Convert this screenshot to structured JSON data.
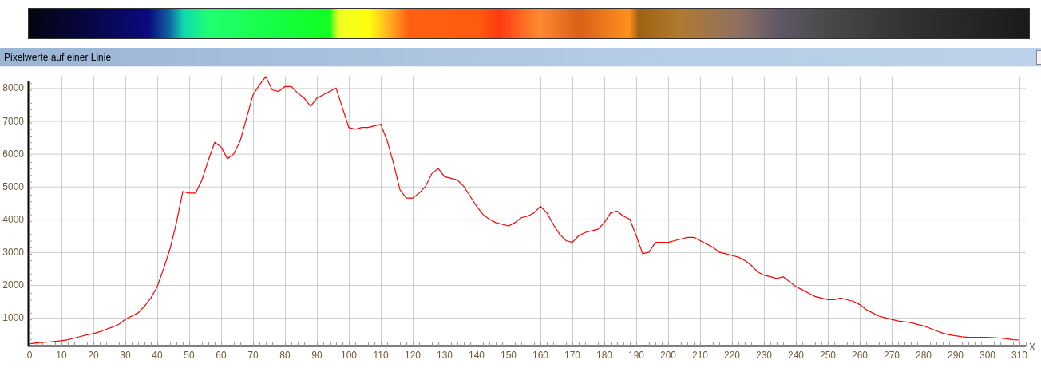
{
  "panel": {
    "title": "Pixelwerte auf einer Linie"
  },
  "chart": {
    "chart_data": {
      "type": "line",
      "grid": true,
      "xlabel": "X",
      "xlim": [
        0,
        312
      ],
      "ylim": [
        150,
        8400
      ],
      "xticks": [
        0,
        10,
        20,
        30,
        40,
        50,
        60,
        70,
        80,
        90,
        100,
        110,
        120,
        130,
        140,
        150,
        160,
        170,
        180,
        190,
        200,
        210,
        220,
        230,
        240,
        250,
        260,
        270,
        280,
        290,
        300,
        310
      ],
      "yticks": [
        1000,
        2000,
        3000,
        4000,
        5000,
        6000,
        7000,
        8000
      ],
      "x": [
        0,
        2,
        4,
        6,
        8,
        10,
        12,
        14,
        16,
        18,
        20,
        22,
        24,
        26,
        28,
        30,
        32,
        34,
        36,
        38,
        40,
        42,
        44,
        46,
        48,
        50,
        52,
        54,
        56,
        58,
        60,
        62,
        64,
        66,
        68,
        70,
        72,
        74,
        76,
        78,
        80,
        82,
        84,
        86,
        88,
        90,
        92,
        94,
        96,
        98,
        100,
        102,
        104,
        106,
        108,
        110,
        112,
        114,
        116,
        118,
        120,
        122,
        124,
        126,
        128,
        130,
        132,
        134,
        136,
        138,
        140,
        142,
        144,
        146,
        148,
        150,
        152,
        154,
        156,
        158,
        160,
        162,
        164,
        166,
        168,
        170,
        172,
        174,
        176,
        178,
        180,
        182,
        184,
        186,
        188,
        190,
        192,
        194,
        196,
        198,
        200,
        202,
        204,
        206,
        208,
        210,
        212,
        214,
        216,
        218,
        220,
        222,
        224,
        226,
        228,
        230,
        232,
        234,
        236,
        238,
        240,
        242,
        244,
        246,
        248,
        250,
        252,
        254,
        256,
        258,
        260,
        262,
        264,
        266,
        268,
        270,
        272,
        274,
        276,
        278,
        280,
        282,
        284,
        286,
        288,
        290,
        292,
        294,
        296,
        298,
        300,
        302,
        304,
        306,
        308,
        310
      ],
      "series": [
        {
          "color": "#ff0000",
          "values": [
            200,
            230,
            250,
            260,
            280,
            300,
            330,
            380,
            430,
            480,
            520,
            570,
            650,
            720,
            800,
            950,
            1050,
            1150,
            1350,
            1600,
            1950,
            2500,
            3100,
            3900,
            4850,
            4800,
            4800,
            5200,
            5800,
            6350,
            6200,
            5850,
            6000,
            6400,
            7100,
            7800,
            8100,
            8350,
            7950,
            7900,
            8050,
            8050,
            7850,
            7700,
            7450,
            7700,
            7800,
            7900,
            8000,
            7400,
            6800,
            6750,
            6800,
            6800,
            6850,
            6900,
            6400,
            5700,
            4900,
            4650,
            4650,
            4800,
            5000,
            5400,
            5550,
            5300,
            5250,
            5200,
            5000,
            4700,
            4400,
            4150,
            4000,
            3900,
            3850,
            3800,
            3900,
            4050,
            4100,
            4200,
            4400,
            4200,
            3850,
            3550,
            3350,
            3300,
            3500,
            3600,
            3650,
            3700,
            3900,
            4200,
            4250,
            4100,
            4000,
            3500,
            2950,
            3000,
            3300,
            3300,
            3300,
            3350,
            3400,
            3450,
            3450,
            3350,
            3250,
            3150,
            3000,
            2950,
            2900,
            2850,
            2750,
            2600,
            2400,
            2300,
            2250,
            2200,
            2250,
            2100,
            1950,
            1850,
            1750,
            1650,
            1600,
            1550,
            1550,
            1600,
            1550,
            1500,
            1400,
            1250,
            1150,
            1050,
            1000,
            950,
            900,
            880,
            850,
            800,
            750,
            680,
            600,
            530,
            480,
            450,
            420,
            400,
            400,
            400,
            400,
            390,
            380,
            360,
            330,
            320
          ]
        }
      ]
    }
  }
}
